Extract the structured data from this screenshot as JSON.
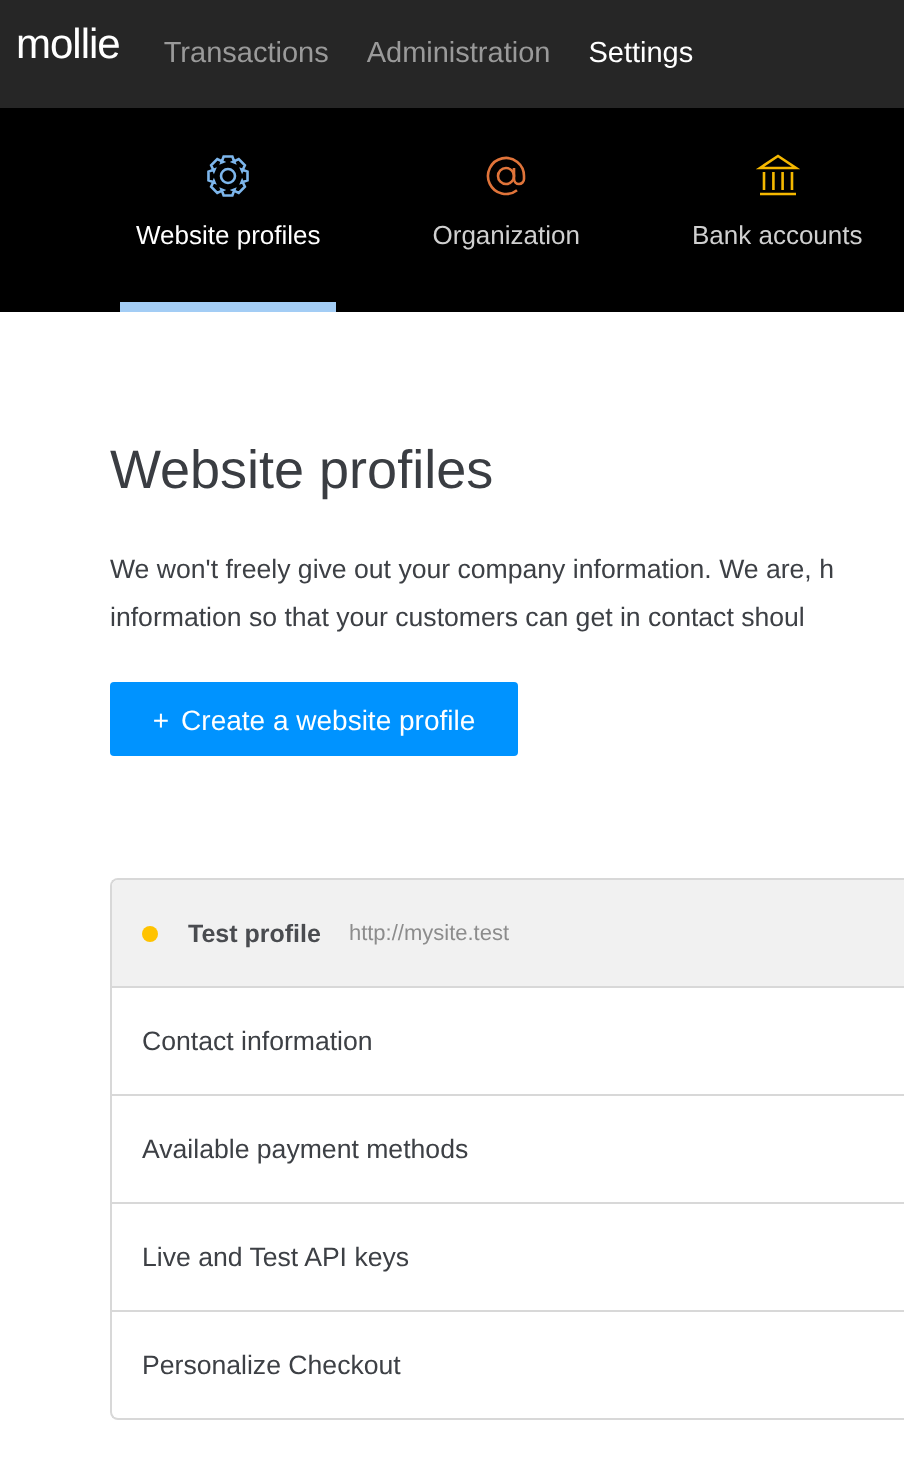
{
  "top_nav": {
    "logo": "mollie",
    "items": [
      {
        "label": "Transactions",
        "selected": false
      },
      {
        "label": "Administration",
        "selected": false
      },
      {
        "label": "Settings",
        "selected": true
      }
    ]
  },
  "settings_tabs": [
    {
      "label": "Website profiles",
      "kind": "gear",
      "color": "#7db6ec",
      "selected": true
    },
    {
      "label": "Organization",
      "kind": "at",
      "color": "#e0743a",
      "selected": false
    },
    {
      "label": "Bank accounts",
      "kind": "bank",
      "color": "#f5b800",
      "selected": false
    }
  ],
  "page": {
    "title": "Website profiles",
    "description_lines": [
      "We won't freely give out your company information. We are, h",
      "information so that your customers can get in contact shoul"
    ],
    "create_button": {
      "icon": "+",
      "label": "Create a website profile"
    }
  },
  "profile": {
    "name": "Test profile",
    "url": "http://mysite.test",
    "color": "#ffc300",
    "items": [
      "Contact information",
      "Available payment methods",
      "Live and Test API keys",
      "Personalize Checkout"
    ]
  }
}
